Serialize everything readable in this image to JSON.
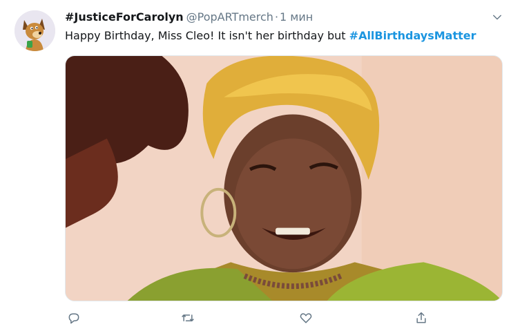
{
  "tweet": {
    "display_name": "#JusticeForCarolyn",
    "handle": "@PopARTmerch",
    "separator": "·",
    "time": "1 мин",
    "text_prefix": "Happy Birthday, Miss Cleo! It isn't her birthday but ",
    "hashtag": "#AllBirthdaysMatter"
  },
  "icons": {
    "avatar": "cartoon-dog-avatar",
    "caret": "chevron-down-icon",
    "reply": "reply-icon",
    "retweet": "retweet-icon",
    "like": "heart-icon",
    "share": "share-icon"
  },
  "colors": {
    "text": "#14171a",
    "secondary": "#657786",
    "link": "#1b95e0"
  }
}
